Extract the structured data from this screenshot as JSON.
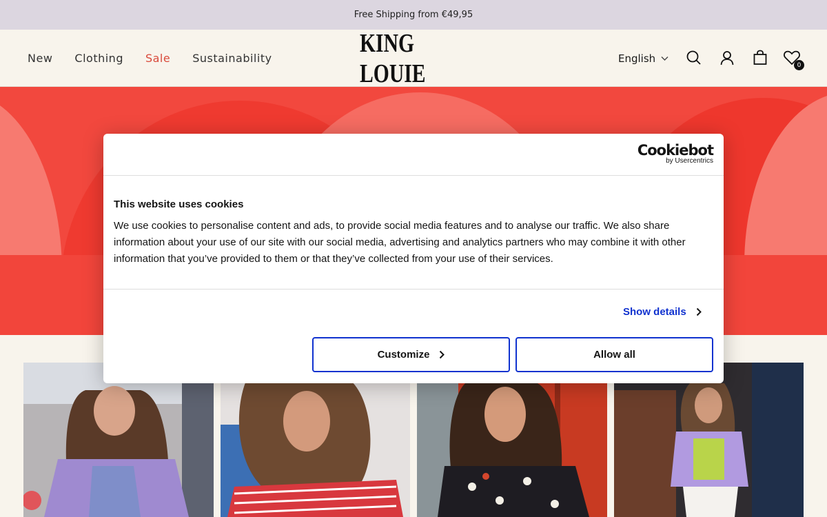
{
  "topbar": {
    "text": "Free Shipping from €49,95"
  },
  "header": {
    "nav": [
      "New",
      "Clothing",
      "Sale",
      "Sustainability"
    ],
    "logo": "KING LOUIE",
    "language": "English",
    "wishlist_count": "0",
    "icons": [
      "search-icon",
      "account-icon",
      "bag-icon",
      "heart-icon"
    ]
  },
  "hero": {
    "colors": {
      "base": "#f2483e",
      "light": "#f77a70"
    }
  },
  "cookie": {
    "brand": "Cookiebot",
    "brand_sub": "by Usercentrics",
    "title": "This website uses cookies",
    "text": "We use cookies to personalise content and ads, to provide social media features and to analyse our traffic. We also share information about your use of our site with our social media, advertising and analytics partners who may combine it with other information that you’ve provided to them or that they’ve collected from your use of their services.",
    "show_details": "Show details",
    "customize": "Customize",
    "allow_all": "Allow all",
    "accent": "#1032cf"
  }
}
